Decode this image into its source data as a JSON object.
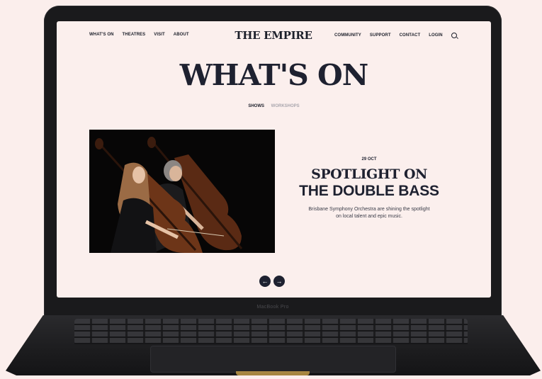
{
  "nav": {
    "left": [
      "WHAT'S ON",
      "THEATRES",
      "VISIT",
      "ABOUT"
    ],
    "logo": "THE EMPIRE",
    "right": [
      "COMMUNITY",
      "SUPPORT",
      "CONTACT",
      "LOGIN"
    ]
  },
  "hero": {
    "title": "WHAT'S ON"
  },
  "tabs": {
    "active": "SHOWS",
    "inactive": "WORKSHOPS"
  },
  "event": {
    "date": "29 OCT",
    "title_line1": "SPOTLIGHT ON",
    "title_line2": "THE DOUBLE BASS",
    "description": "Brisbane Symphony Orchestra are shining the spotlight on local talent and epic music."
  },
  "carousel": {
    "prev": "←",
    "next": "→"
  },
  "device": {
    "label": "MacBook Pro"
  },
  "colors": {
    "background": "#fbeeec",
    "ink": "#1e2130",
    "muted": "#a9a6ad"
  },
  "icons": [
    "search-icon",
    "arrow-left-icon",
    "arrow-right-icon"
  ]
}
